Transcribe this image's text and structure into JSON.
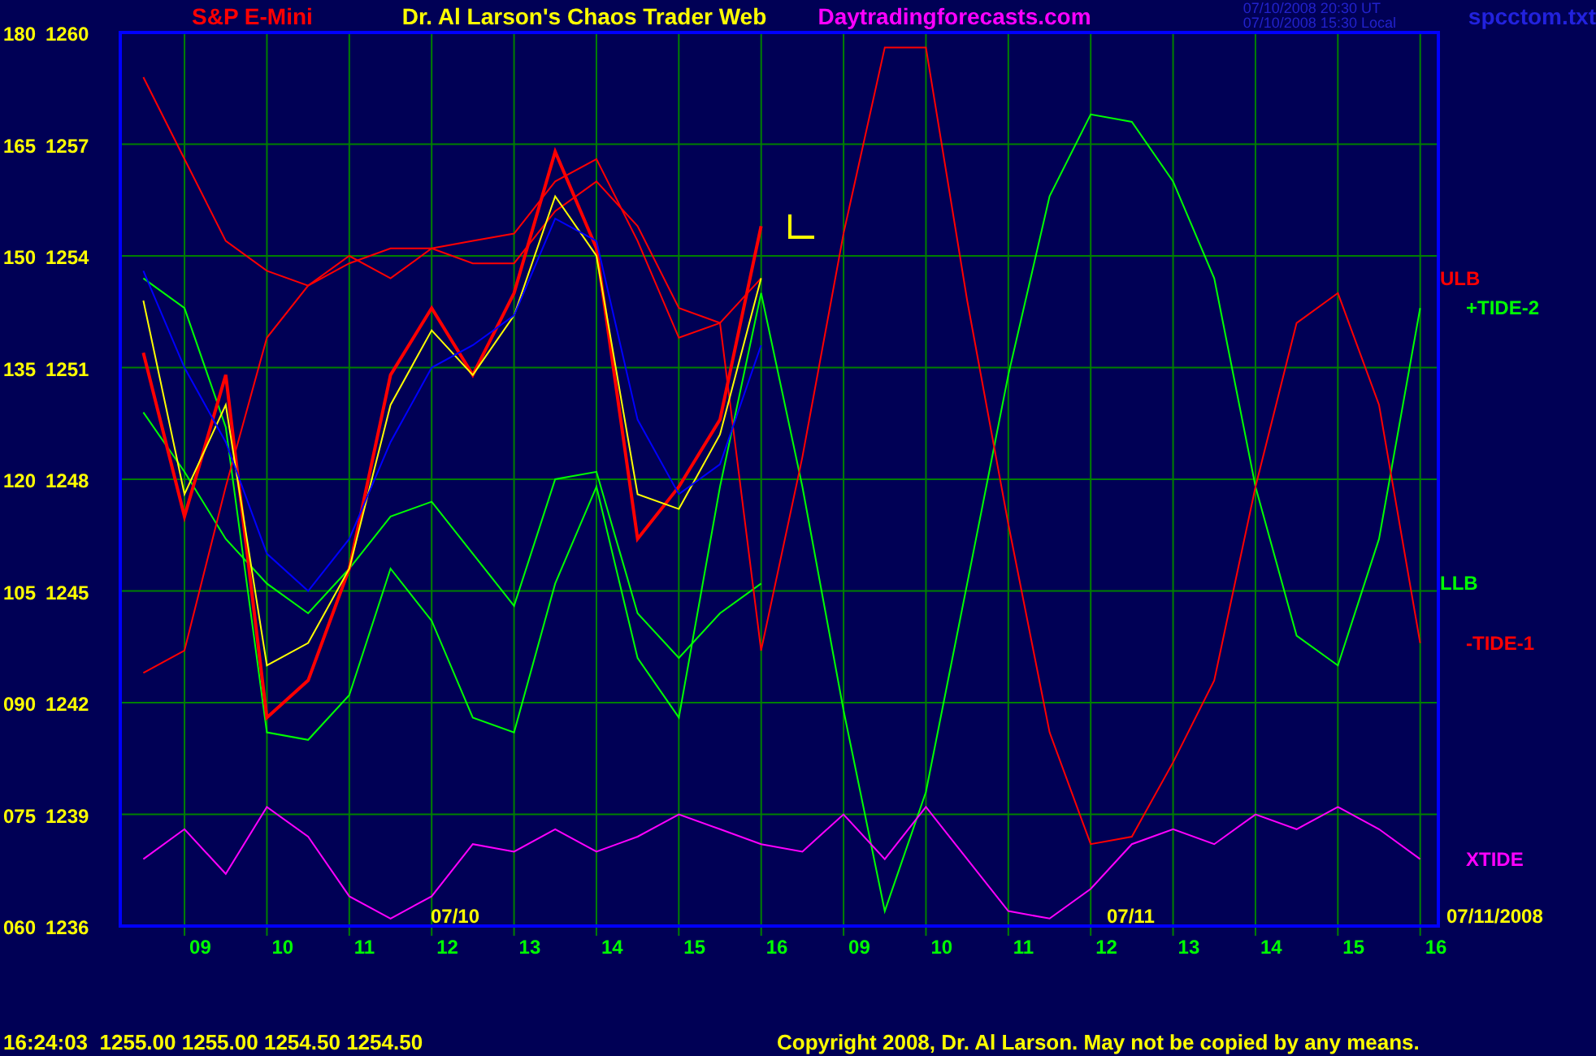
{
  "header": {
    "instrument": "S&P E-Mini",
    "title": "Dr. Al Larson's Chaos Trader Web",
    "site": "Daytradingforecasts.com",
    "timestamps": [
      "07/10/2008 20:30 UT",
      "07/10/2008 15:30 Local"
    ],
    "file": "spcctom.txt"
  },
  "chart": {
    "chart_data": {
      "type": "line",
      "categories": [
        null,
        "09",
        null,
        "10",
        null,
        "11",
        null,
        "12",
        null,
        "13",
        null,
        "14",
        null,
        "15",
        null,
        "16",
        null,
        "09",
        null,
        "10",
        null,
        "11",
        null,
        "12",
        null,
        "13",
        null,
        "14",
        null,
        "15",
        null,
        "16"
      ],
      "ylim": [
        60,
        180
      ],
      "grid": true,
      "yticks": [
        {
          "value": 180,
          "label": "180"
        },
        {
          "value": 165,
          "label": "165"
        },
        {
          "value": 150,
          "label": "150"
        },
        {
          "value": 135,
          "label": "135"
        },
        {
          "value": 120,
          "label": "120"
        },
        {
          "value": 105,
          "label": "105"
        },
        {
          "value": 90,
          "label": "090"
        },
        {
          "value": 75,
          "label": "075"
        },
        {
          "value": 60,
          "label": "060"
        }
      ],
      "series": [
        {
          "name": "ULB",
          "color": "#ff0000",
          "values": [
            174,
            163,
            152,
            148,
            146,
            150,
            147,
            151,
            152,
            153,
            160,
            163,
            152,
            139,
            141,
            147,
            null,
            null,
            null,
            null,
            null,
            null,
            null,
            null,
            null,
            null,
            null,
            null,
            null,
            null,
            null,
            null
          ]
        },
        {
          "name": "+TIDE-2",
          "color": "#00ff00",
          "values": [
            147,
            143,
            127,
            86,
            85,
            91,
            108,
            101,
            88,
            86,
            106,
            119,
            96,
            88,
            119,
            145,
            119,
            89,
            62,
            78,
            106,
            134,
            158,
            169,
            168,
            160,
            147,
            119,
            99,
            95,
            112,
            143
          ]
        },
        {
          "name": "LLB",
          "color": "#00ff00",
          "values": [
            129,
            121,
            112,
            106,
            102,
            108,
            115,
            117,
            110,
            103,
            120,
            121,
            102,
            96,
            102,
            106,
            null,
            null,
            null,
            null,
            null,
            null,
            null,
            null,
            null,
            null,
            null,
            null,
            null,
            null,
            null,
            null
          ]
        },
        {
          "name": "-TIDE-1",
          "color": "#ff0000",
          "values": [
            94,
            97,
            119,
            139,
            146,
            149,
            151,
            151,
            149,
            149,
            156,
            160,
            154,
            143,
            141,
            97,
            123,
            153,
            178,
            178,
            144,
            114,
            86,
            71,
            72,
            82,
            93,
            119,
            141,
            145,
            130,
            98
          ]
        },
        {
          "name": "XTIDE",
          "color": "#ff00ff",
          "values": [
            69,
            73,
            67,
            76,
            72,
            64,
            61,
            64,
            71,
            70,
            73,
            70,
            72,
            75,
            73,
            71,
            70,
            75,
            69,
            76,
            69,
            62,
            61,
            65,
            71,
            73,
            71,
            75,
            73,
            76,
            73,
            69
          ]
        },
        {
          "color": "#ff0000",
          "values": [
            137,
            115,
            134,
            88,
            93,
            108,
            134,
            143,
            134,
            145,
            164,
            151,
            112,
            119,
            128,
            154,
            null,
            null,
            null,
            null,
            null,
            null,
            null,
            null,
            null,
            null,
            null,
            null,
            null,
            null,
            null,
            null
          ]
        },
        {
          "color": "#ffff00",
          "values": [
            144,
            118,
            130,
            95,
            98,
            108,
            130,
            140,
            134,
            142,
            158,
            150,
            118,
            116,
            126,
            147,
            null,
            null,
            null,
            null,
            null,
            null,
            null,
            null,
            null,
            null,
            null,
            null,
            null,
            null,
            null,
            null
          ]
        },
        {
          "color": "#0000ff",
          "values": [
            148,
            135,
            125,
            110,
            105,
            112,
            125,
            135,
            138,
            142,
            155,
            152,
            128,
            118,
            122,
            138,
            null,
            null,
            null,
            null,
            null,
            null,
            null,
            null,
            null,
            null,
            null,
            null,
            null,
            null,
            null,
            null
          ]
        }
      ]
    },
    "price_labels": [
      "1260",
      "1257",
      "1254",
      "1251",
      "1248",
      "1245",
      "1242",
      "1239",
      "1236"
    ],
    "date_labels": [
      "07/10",
      "07/11",
      "07/11/2008"
    ]
  },
  "status": {
    "quote": "16:24:03  1255.00 1255.00 1254.50 1254.50",
    "copyright": "Copyright 2008, Dr. Al Larson. May not be copied by any means."
  }
}
